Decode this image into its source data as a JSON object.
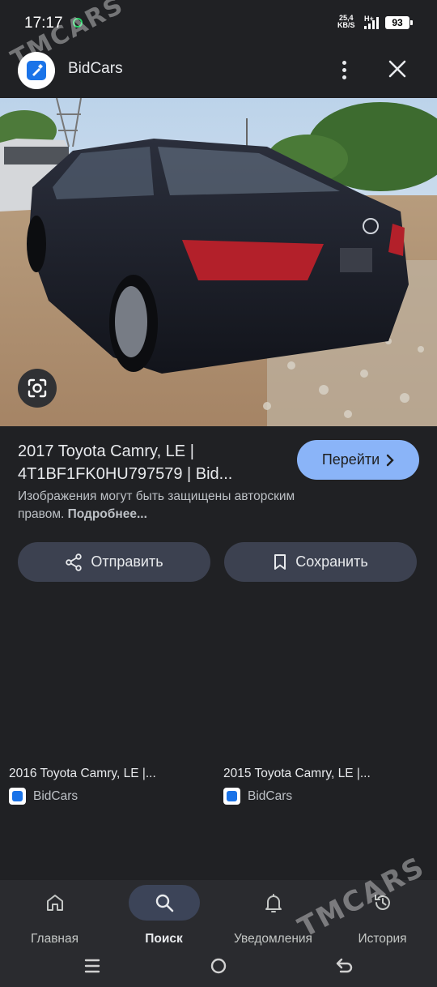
{
  "status_bar": {
    "time": "17:17",
    "net_speed_value": "25,4",
    "net_speed_unit": "KB/S",
    "network_type": "H+",
    "battery": "93"
  },
  "header": {
    "site_name": "BidCars"
  },
  "result": {
    "title_line1": "2017 Toyota Camry, LE |",
    "title_line2": "4T1BF1FK0HU797579 | Bid...",
    "go_label": "Перейти",
    "copyright_text": "Изображения могут быть защищены авторским правом. ",
    "copyright_link": "Подробнее..."
  },
  "actions": {
    "share_label": "Отправить",
    "save_label": "Сохранить"
  },
  "related": [
    {
      "title": "2016 Toyota Camry, LE |...",
      "source": "BidCars"
    },
    {
      "title": "2015 Toyota Camry, LE |...",
      "source": "BidCars"
    }
  ],
  "bottom_nav": [
    {
      "label": "Главная",
      "icon": "home-icon",
      "active": false
    },
    {
      "label": "Поиск",
      "icon": "search-icon",
      "active": true
    },
    {
      "label": "Уведомления",
      "icon": "bell-icon",
      "active": false
    },
    {
      "label": "История",
      "icon": "history-icon",
      "active": false
    }
  ],
  "watermark": {
    "top": "TMCARS",
    "bottom": "TMCARS"
  },
  "colors": {
    "background": "#202124",
    "accent": "#8ab4f8",
    "button_bg": "#3c4150"
  }
}
